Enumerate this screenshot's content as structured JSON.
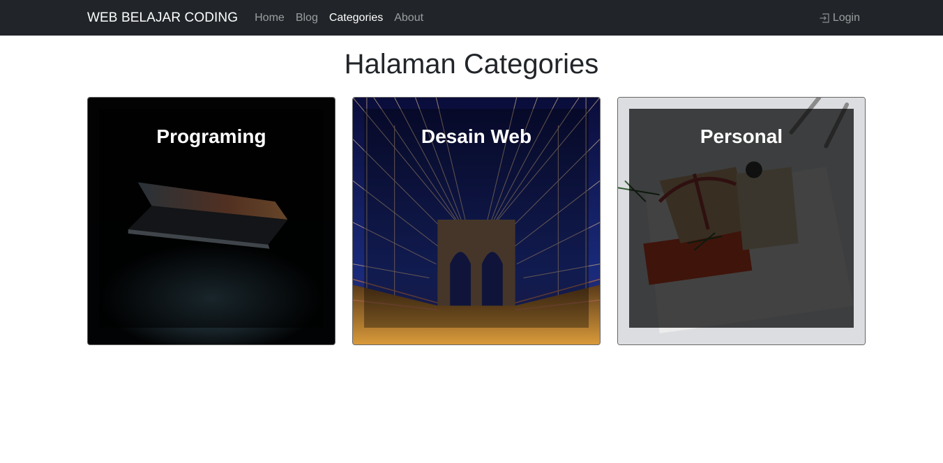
{
  "navbar": {
    "brand": "WEB BELAJAR CODING",
    "links": [
      {
        "label": "Home"
      },
      {
        "label": "Blog"
      },
      {
        "label": "Categories",
        "active": true
      },
      {
        "label": "About"
      }
    ],
    "login_label": "Login",
    "login_icon": "box-arrow-in-right-icon"
  },
  "page": {
    "title": "Halaman Categories"
  },
  "categories": [
    {
      "name": "Programing",
      "image": "dark laptop"
    },
    {
      "name": "Desain Web",
      "image": "bridge at night"
    },
    {
      "name": "Personal",
      "image": "gift illustration"
    }
  ],
  "colors": {
    "navbar_bg": "#212529",
    "nav_active": "#ffffff",
    "nav_muted": "#8c8e91",
    "overlay": "rgba(0,0,0,0.7)"
  }
}
